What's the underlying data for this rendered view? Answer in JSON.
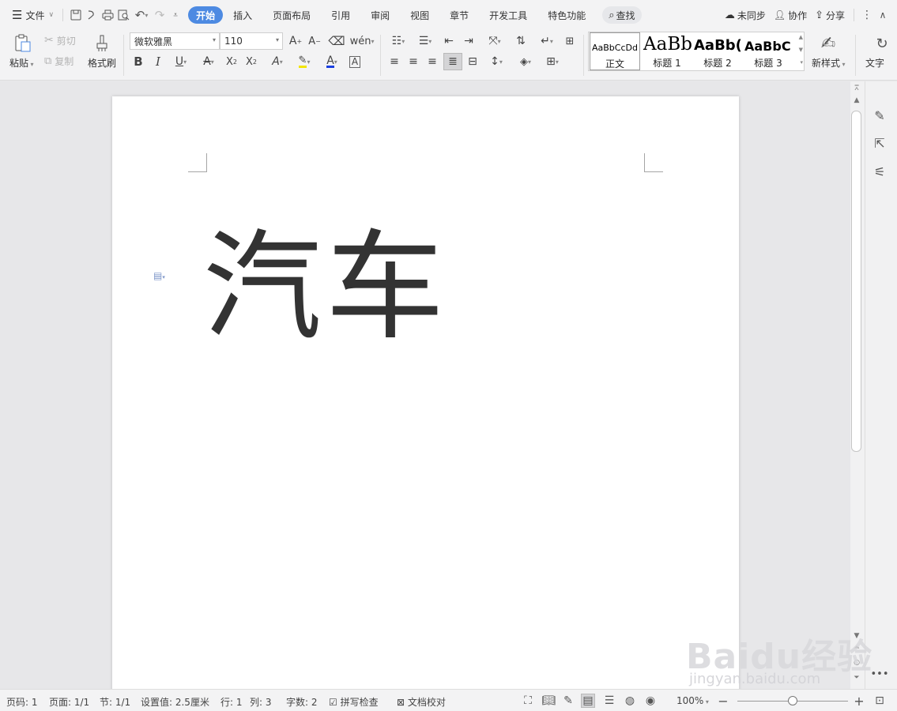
{
  "menubar": {
    "file_label": "文件",
    "tabs": [
      {
        "label": "开始",
        "active": true
      },
      {
        "label": "插入",
        "active": false
      },
      {
        "label": "页面布局",
        "active": false
      },
      {
        "label": "引用",
        "active": false
      },
      {
        "label": "审阅",
        "active": false
      },
      {
        "label": "视图",
        "active": false
      },
      {
        "label": "章节",
        "active": false
      },
      {
        "label": "开发工具",
        "active": false
      },
      {
        "label": "特色功能",
        "active": false
      }
    ],
    "search_label": "查找",
    "sync_label": "未同步",
    "collab_label": "协作",
    "share_label": "分享"
  },
  "ribbon": {
    "paste_label": "粘贴",
    "cut_label": "剪切",
    "copy_label": "复制",
    "format_painter_label": "格式刷",
    "font_name": "微软雅黑",
    "font_size": "110",
    "styles": [
      {
        "preview": "AaBbCcDd",
        "name": "正文"
      },
      {
        "preview": "AaBb",
        "name": "标题 1"
      },
      {
        "preview": "AaBb(",
        "name": "标题 2"
      },
      {
        "preview": "AaBbC",
        "name": "标题 3"
      }
    ],
    "new_style_label": "新样式",
    "text_tool_label": "文字"
  },
  "document": {
    "text": "汽车"
  },
  "statusbar": {
    "page_num": "页码: 1",
    "pages": "页面: 1/1",
    "section": "节: 1/1",
    "setting": "设置值: 2.5厘米",
    "row": "行: 1",
    "col": "列: 3",
    "word_count": "字数: 2",
    "spell_check": "拼写检查",
    "doc_proof": "文档校对",
    "zoom": "100%"
  },
  "zoom_level": 0.5,
  "watermark": {
    "brand": "Baidu经验",
    "url": "jingyan.baidu.com"
  },
  "colors": {
    "accent": "#4d8ae2",
    "font_color_underline": "#1a3fe0",
    "highlight_underline": "#f2e500",
    "text_effect_underline": "#e04545"
  }
}
